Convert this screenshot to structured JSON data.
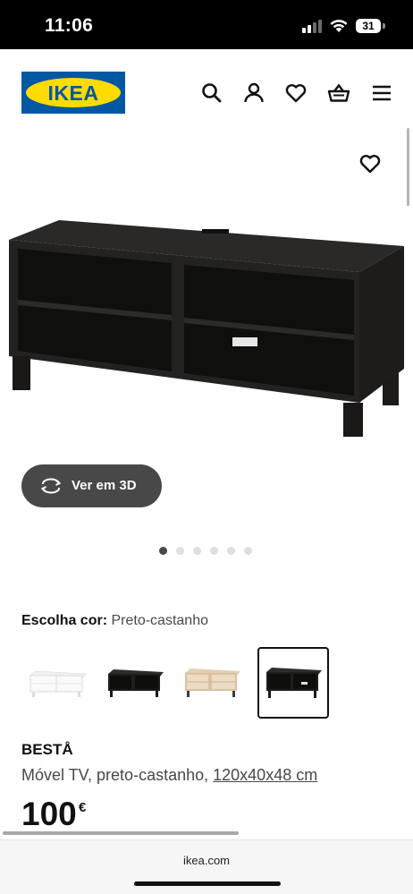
{
  "status_bar": {
    "time": "11:06",
    "battery": "31"
  },
  "header": {
    "logo_text": "IKEA"
  },
  "product": {
    "view_3d_label": "Ver em 3D",
    "image_count": 6,
    "active_image_index": 0,
    "colour_label": "Escolha cor:",
    "colour_value": "Preto-castanho",
    "swatches": [
      {
        "name": "branco",
        "selected": false
      },
      {
        "name": "preto-castanho",
        "selected": false
      },
      {
        "name": "efeito carvalho",
        "selected": false
      },
      {
        "name": "preto-castanho",
        "selected": true
      }
    ],
    "name": "BESTÅ",
    "description": "Móvel TV, preto-castanho,",
    "size": "120x40x48 cm",
    "price": "100",
    "currency": "€"
  },
  "browser": {
    "url": "ikea.com"
  },
  "colors": {
    "ikea_blue": "#0058a3",
    "ikea_yellow": "#ffdb00",
    "dark_button": "#484848"
  },
  "icons": [
    "search-icon",
    "user-icon",
    "heart-icon",
    "shopping-bag-icon",
    "menu-icon",
    "rotate-3d-icon"
  ]
}
